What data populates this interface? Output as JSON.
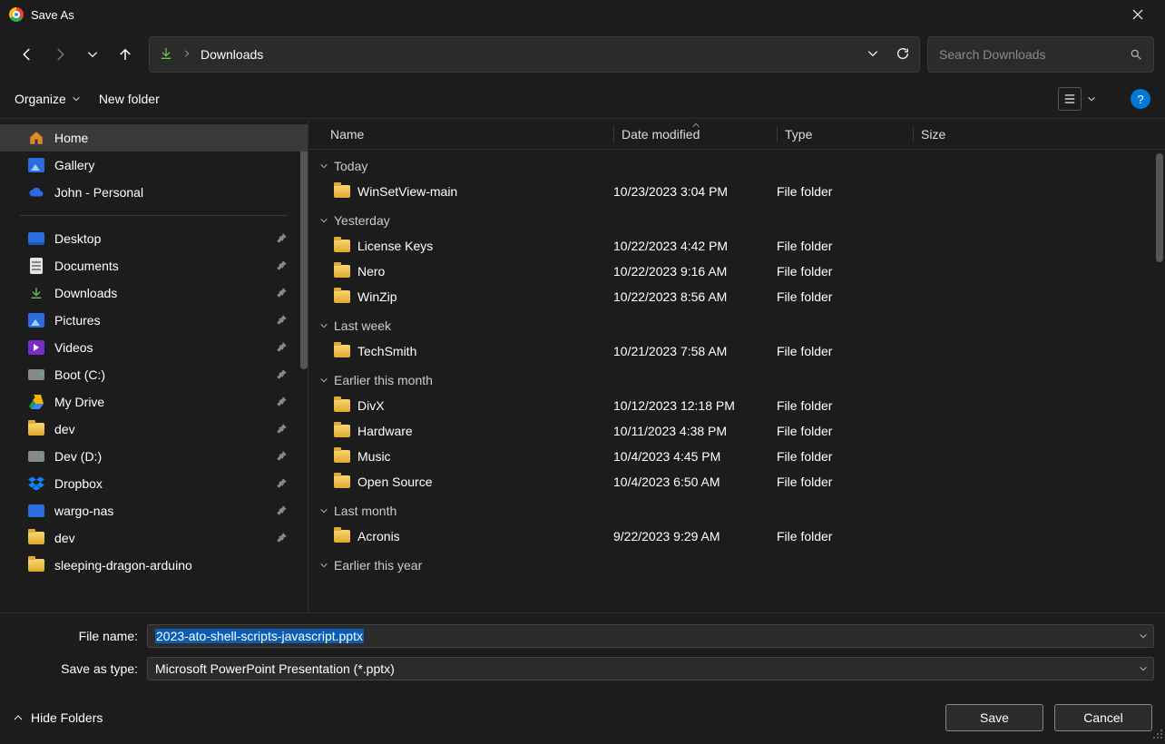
{
  "titlebar": {
    "title": "Save As"
  },
  "nav": {
    "location": "Downloads"
  },
  "search": {
    "placeholder": "Search Downloads"
  },
  "toolbar": {
    "organize": "Organize",
    "new_folder": "New folder",
    "help": "?"
  },
  "sidebar": {
    "top": [
      {
        "label": "Home",
        "icon": "home",
        "selected": true
      },
      {
        "label": "Gallery",
        "icon": "gallery"
      },
      {
        "label": "John - Personal",
        "icon": "cloud"
      }
    ],
    "items": [
      {
        "label": "Desktop",
        "icon": "desktop",
        "pinned": true
      },
      {
        "label": "Documents",
        "icon": "doc",
        "pinned": true
      },
      {
        "label": "Downloads",
        "icon": "dl",
        "pinned": true
      },
      {
        "label": "Pictures",
        "icon": "pic",
        "pinned": true
      },
      {
        "label": "Videos",
        "icon": "vid",
        "pinned": true
      },
      {
        "label": "Boot (C:)",
        "icon": "drive",
        "pinned": true
      },
      {
        "label": "My Drive",
        "icon": "gdrive",
        "pinned": true
      },
      {
        "label": "dev",
        "icon": "folder",
        "pinned": true
      },
      {
        "label": "Dev (D:)",
        "icon": "drive",
        "pinned": true
      },
      {
        "label": "Dropbox",
        "icon": "dropbox",
        "pinned": true
      },
      {
        "label": "wargo-nas",
        "icon": "nas",
        "pinned": true
      },
      {
        "label": "dev",
        "icon": "folder",
        "pinned": true
      },
      {
        "label": "sleeping-dragon-arduino",
        "icon": "folder",
        "pinned": false
      }
    ]
  },
  "columns": {
    "name": "Name",
    "date": "Date modified",
    "type": "Type",
    "size": "Size"
  },
  "groups": [
    {
      "label": "Today",
      "rows": [
        {
          "name": "WinSetView-main",
          "date": "10/23/2023 3:04 PM",
          "type": "File folder"
        }
      ]
    },
    {
      "label": "Yesterday",
      "rows": [
        {
          "name": "License Keys",
          "date": "10/22/2023 4:42 PM",
          "type": "File folder"
        },
        {
          "name": "Nero",
          "date": "10/22/2023 9:16 AM",
          "type": "File folder"
        },
        {
          "name": "WinZip",
          "date": "10/22/2023 8:56 AM",
          "type": "File folder"
        }
      ]
    },
    {
      "label": "Last week",
      "rows": [
        {
          "name": "TechSmith",
          "date": "10/21/2023 7:58 AM",
          "type": "File folder"
        }
      ]
    },
    {
      "label": "Earlier this month",
      "rows": [
        {
          "name": "DivX",
          "date": "10/12/2023 12:18 PM",
          "type": "File folder"
        },
        {
          "name": "Hardware",
          "date": "10/11/2023 4:38 PM",
          "type": "File folder"
        },
        {
          "name": "Music",
          "date": "10/4/2023 4:45 PM",
          "type": "File folder"
        },
        {
          "name": "Open Source",
          "date": "10/4/2023 6:50 AM",
          "type": "File folder"
        }
      ]
    },
    {
      "label": "Last month",
      "rows": [
        {
          "name": "Acronis",
          "date": "9/22/2023 9:29 AM",
          "type": "File folder"
        }
      ]
    },
    {
      "label": "Earlier this year",
      "rows": []
    }
  ],
  "fields": {
    "filename_label": "File name:",
    "filename_value": "2023-ato-shell-scripts-javascript.pptx",
    "type_label": "Save as type:",
    "type_value": "Microsoft PowerPoint Presentation (*.pptx)"
  },
  "footer": {
    "hide": "Hide Folders",
    "save": "Save",
    "cancel": "Cancel"
  }
}
